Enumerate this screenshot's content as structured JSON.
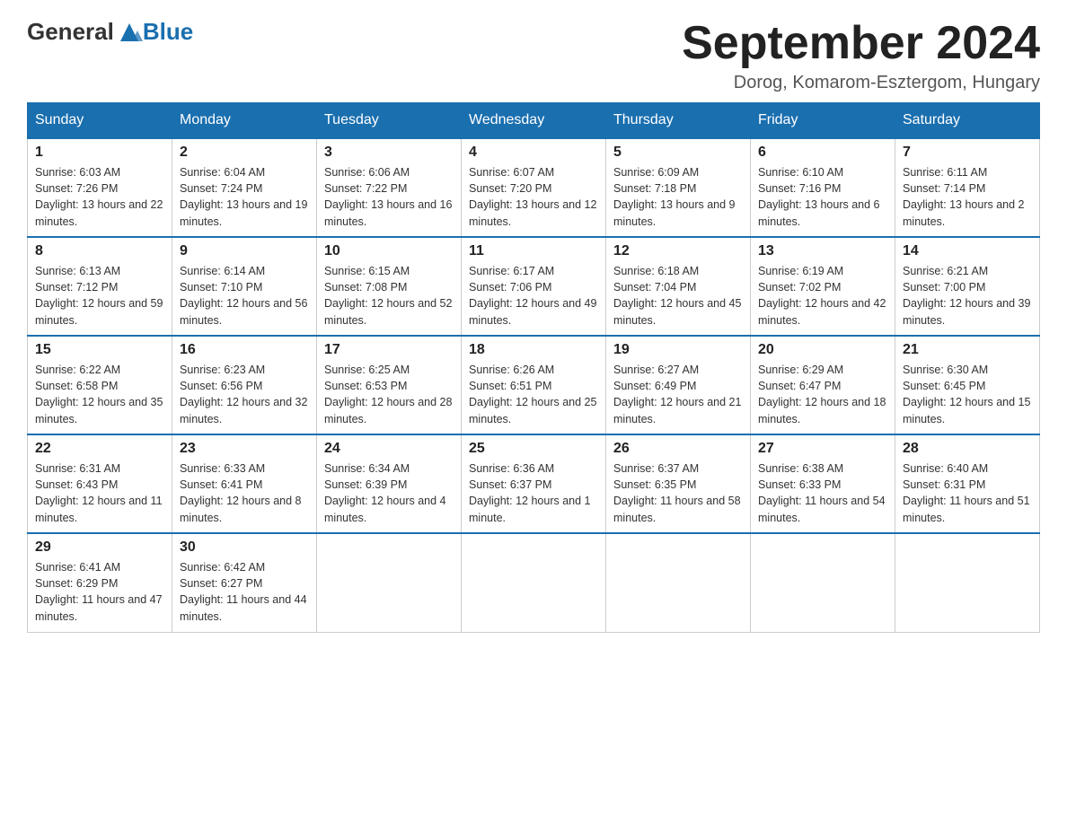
{
  "header": {
    "logo_general": "General",
    "logo_blue": "Blue",
    "month_year": "September 2024",
    "location": "Dorog, Komarom-Esztergom, Hungary"
  },
  "days_of_week": [
    "Sunday",
    "Monday",
    "Tuesday",
    "Wednesday",
    "Thursday",
    "Friday",
    "Saturday"
  ],
  "weeks": [
    [
      {
        "day": "1",
        "sunrise": "6:03 AM",
        "sunset": "7:26 PM",
        "daylight": "13 hours and 22 minutes."
      },
      {
        "day": "2",
        "sunrise": "6:04 AM",
        "sunset": "7:24 PM",
        "daylight": "13 hours and 19 minutes."
      },
      {
        "day": "3",
        "sunrise": "6:06 AM",
        "sunset": "7:22 PM",
        "daylight": "13 hours and 16 minutes."
      },
      {
        "day": "4",
        "sunrise": "6:07 AM",
        "sunset": "7:20 PM",
        "daylight": "13 hours and 12 minutes."
      },
      {
        "day": "5",
        "sunrise": "6:09 AM",
        "sunset": "7:18 PM",
        "daylight": "13 hours and 9 minutes."
      },
      {
        "day": "6",
        "sunrise": "6:10 AM",
        "sunset": "7:16 PM",
        "daylight": "13 hours and 6 minutes."
      },
      {
        "day": "7",
        "sunrise": "6:11 AM",
        "sunset": "7:14 PM",
        "daylight": "13 hours and 2 minutes."
      }
    ],
    [
      {
        "day": "8",
        "sunrise": "6:13 AM",
        "sunset": "7:12 PM",
        "daylight": "12 hours and 59 minutes."
      },
      {
        "day": "9",
        "sunrise": "6:14 AM",
        "sunset": "7:10 PM",
        "daylight": "12 hours and 56 minutes."
      },
      {
        "day": "10",
        "sunrise": "6:15 AM",
        "sunset": "7:08 PM",
        "daylight": "12 hours and 52 minutes."
      },
      {
        "day": "11",
        "sunrise": "6:17 AM",
        "sunset": "7:06 PM",
        "daylight": "12 hours and 49 minutes."
      },
      {
        "day": "12",
        "sunrise": "6:18 AM",
        "sunset": "7:04 PM",
        "daylight": "12 hours and 45 minutes."
      },
      {
        "day": "13",
        "sunrise": "6:19 AM",
        "sunset": "7:02 PM",
        "daylight": "12 hours and 42 minutes."
      },
      {
        "day": "14",
        "sunrise": "6:21 AM",
        "sunset": "7:00 PM",
        "daylight": "12 hours and 39 minutes."
      }
    ],
    [
      {
        "day": "15",
        "sunrise": "6:22 AM",
        "sunset": "6:58 PM",
        "daylight": "12 hours and 35 minutes."
      },
      {
        "day": "16",
        "sunrise": "6:23 AM",
        "sunset": "6:56 PM",
        "daylight": "12 hours and 32 minutes."
      },
      {
        "day": "17",
        "sunrise": "6:25 AM",
        "sunset": "6:53 PM",
        "daylight": "12 hours and 28 minutes."
      },
      {
        "day": "18",
        "sunrise": "6:26 AM",
        "sunset": "6:51 PM",
        "daylight": "12 hours and 25 minutes."
      },
      {
        "day": "19",
        "sunrise": "6:27 AM",
        "sunset": "6:49 PM",
        "daylight": "12 hours and 21 minutes."
      },
      {
        "day": "20",
        "sunrise": "6:29 AM",
        "sunset": "6:47 PM",
        "daylight": "12 hours and 18 minutes."
      },
      {
        "day": "21",
        "sunrise": "6:30 AM",
        "sunset": "6:45 PM",
        "daylight": "12 hours and 15 minutes."
      }
    ],
    [
      {
        "day": "22",
        "sunrise": "6:31 AM",
        "sunset": "6:43 PM",
        "daylight": "12 hours and 11 minutes."
      },
      {
        "day": "23",
        "sunrise": "6:33 AM",
        "sunset": "6:41 PM",
        "daylight": "12 hours and 8 minutes."
      },
      {
        "day": "24",
        "sunrise": "6:34 AM",
        "sunset": "6:39 PM",
        "daylight": "12 hours and 4 minutes."
      },
      {
        "day": "25",
        "sunrise": "6:36 AM",
        "sunset": "6:37 PM",
        "daylight": "12 hours and 1 minute."
      },
      {
        "day": "26",
        "sunrise": "6:37 AM",
        "sunset": "6:35 PM",
        "daylight": "11 hours and 58 minutes."
      },
      {
        "day": "27",
        "sunrise": "6:38 AM",
        "sunset": "6:33 PM",
        "daylight": "11 hours and 54 minutes."
      },
      {
        "day": "28",
        "sunrise": "6:40 AM",
        "sunset": "6:31 PM",
        "daylight": "11 hours and 51 minutes."
      }
    ],
    [
      {
        "day": "29",
        "sunrise": "6:41 AM",
        "sunset": "6:29 PM",
        "daylight": "11 hours and 47 minutes."
      },
      {
        "day": "30",
        "sunrise": "6:42 AM",
        "sunset": "6:27 PM",
        "daylight": "11 hours and 44 minutes."
      },
      null,
      null,
      null,
      null,
      null
    ]
  ]
}
